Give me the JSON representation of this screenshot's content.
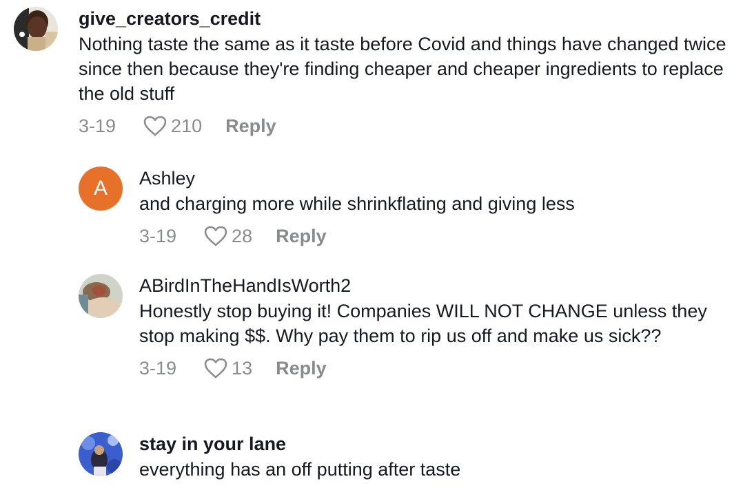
{
  "comments": [
    {
      "username": "give_creators_credit",
      "text": "Nothing taste the same as it taste before Covid and things have changed twice since then because they're finding cheaper and cheaper ingredients to replace the old stuff",
      "date": "3-19",
      "likes": "210",
      "reply_label": "Reply"
    },
    {
      "username": "Ashley",
      "avatar_letter": "A",
      "avatar_color": "#e8712a",
      "text": "and charging more while shrinkflating and giving less",
      "date": "3-19",
      "likes": "28",
      "reply_label": "Reply"
    },
    {
      "username": "ABirdInTheHandIsWorth2",
      "text": "Honestly stop buying it! Companies WILL NOT CHANGE unless they stop making $$. Why pay them to rip us off and make us sick??",
      "date": "3-19",
      "likes": "13",
      "reply_label": "Reply"
    },
    {
      "username": "stay in your lane",
      "text": "everything has an off putting after taste"
    }
  ],
  "icons": {
    "like": "heart-outline-icon"
  },
  "colors": {
    "meta_gray": "#8a8b91",
    "text": "#161823"
  }
}
